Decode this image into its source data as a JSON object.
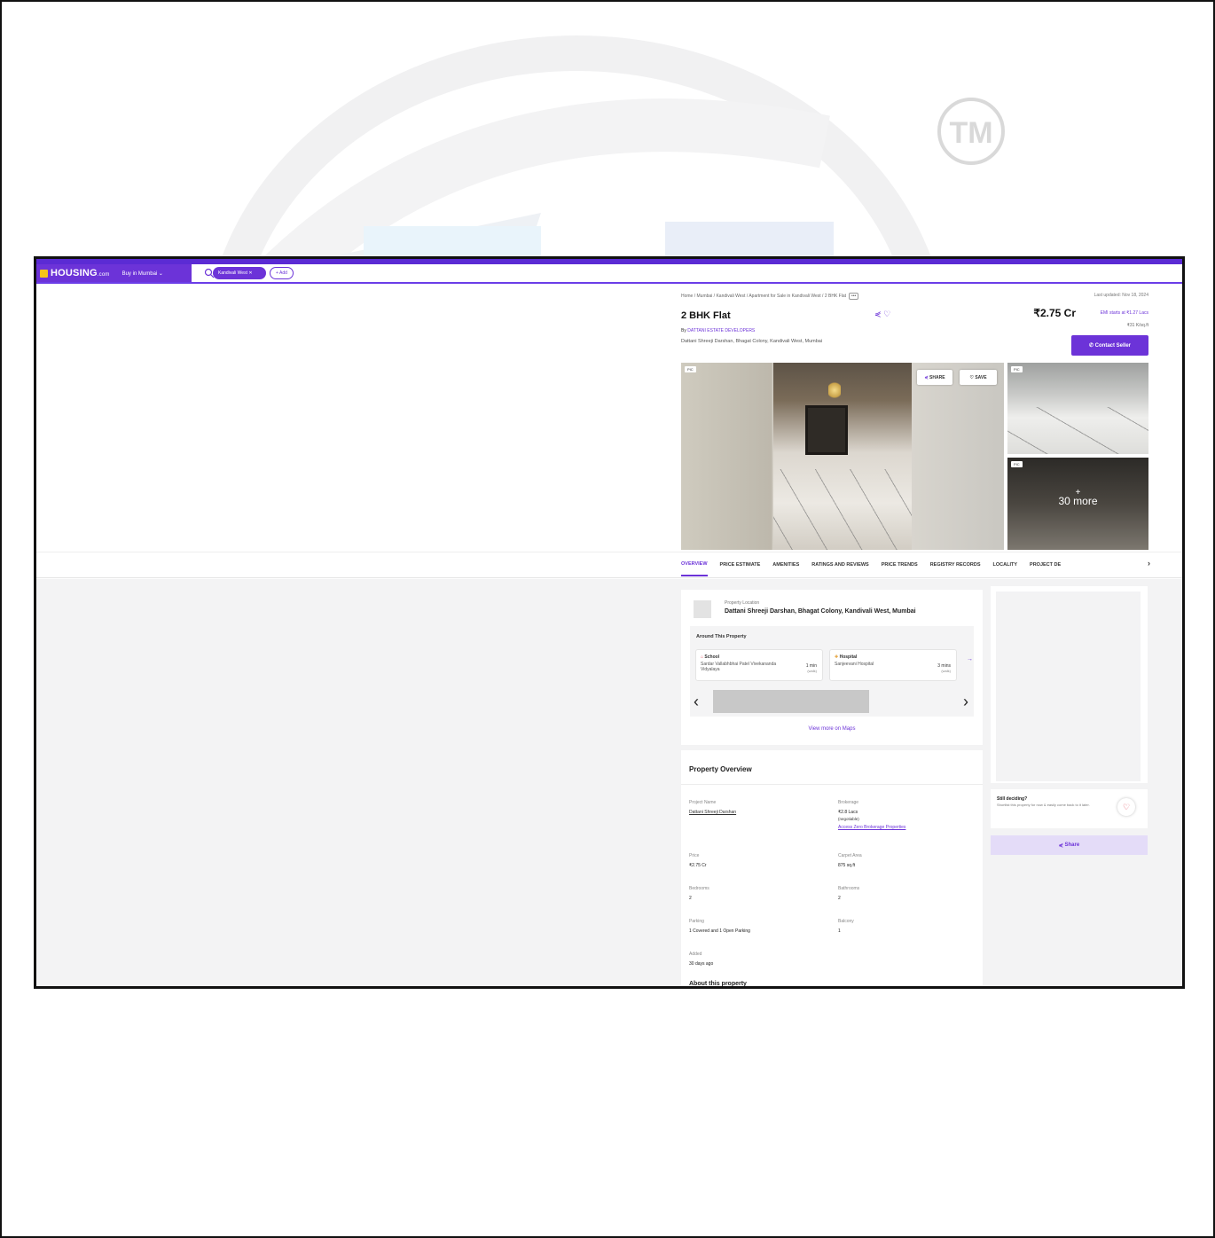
{
  "watermark": {
    "mark_text": "TM"
  },
  "header": {
    "brand": "HOUSING",
    "brand_suffix": ".com",
    "city_select": "Buy in Mumbai",
    "search_chip": "Kandivali West",
    "add_chip": "+ Add"
  },
  "listing": {
    "breadcrumb": "Home / Mumbai / Kandivali West / Apartment for Sale in Kandivali West / 2 BHK Flat",
    "breadcrumb_more": "•••",
    "last_updated": "Last updated: Nov 18, 2024",
    "title": "2 BHK Flat",
    "price": "₹2.75 Cr",
    "emi": "EMI starts at ₹1.27 Lacs",
    "price_per_sqft": "₹31 K/sq.ft",
    "builder_prefix": "By",
    "builder": "DATTANI ESTATE DEVELOPERS",
    "address": "Dattani Shreeji Darshan, Bhagat Colony, Kandivali West, Mumbai",
    "contact_button": "Contact Seller"
  },
  "gallery": {
    "tag": "PIC",
    "share": "SHARE",
    "save": "SAVE",
    "more_plus": "+",
    "more_count": "30 more"
  },
  "tabs": [
    "OVERVIEW",
    "PRICE ESTIMATE",
    "AMENITIES",
    "RATINGS AND REVIEWS",
    "PRICE TRENDS",
    "REGISTRY RECORDS",
    "LOCALITY",
    "PROJECT DE"
  ],
  "location": {
    "label": "Property Location",
    "value": "Dattani Shreeji Darshan, Bhagat Colony, Kandivali West, Mumbai",
    "around_title": "Around This Property",
    "pois": [
      {
        "type": "School",
        "name": "Sardar Vallabhbhai Patel Vivekananda Vidyalaya",
        "dist": "1 min",
        "mode": "(walk)"
      },
      {
        "type": "Hospital",
        "name": "Sanjeevani Hospital",
        "dist": "3 mins",
        "mode": "(walk)"
      }
    ],
    "view_maps": "View more on Maps"
  },
  "overview": {
    "title": "Property Overview",
    "project_name_key": "Project Name",
    "project_name_val": "Dattani Shreeji Darshan",
    "brokerage_key": "Brokerage",
    "brokerage_val": "₹2.8 Lacs",
    "brokerage_note": "(negotiable)",
    "brokerage_link": "Access Zero Brokerage Properties",
    "price_key": "Price",
    "price_val": "₹2.75 Cr",
    "carpet_key": "Carpet Area",
    "carpet_val": "875 sq.ft",
    "bedrooms_key": "Bedrooms",
    "bedrooms_val": "2",
    "bathrooms_key": "Bathrooms",
    "bathrooms_val": "2",
    "parking_key": "Parking",
    "parking_val": "1 Covered and 1 Open Parking",
    "balcony_key": "Balcony",
    "balcony_val": "1",
    "added_key": "Added",
    "added_val": "30 days ago",
    "about": "About this property"
  },
  "side": {
    "deciding_title": "Still deciding?",
    "deciding_text": "Shortlist this property for now & easily come back to it later.",
    "share": "Share"
  }
}
